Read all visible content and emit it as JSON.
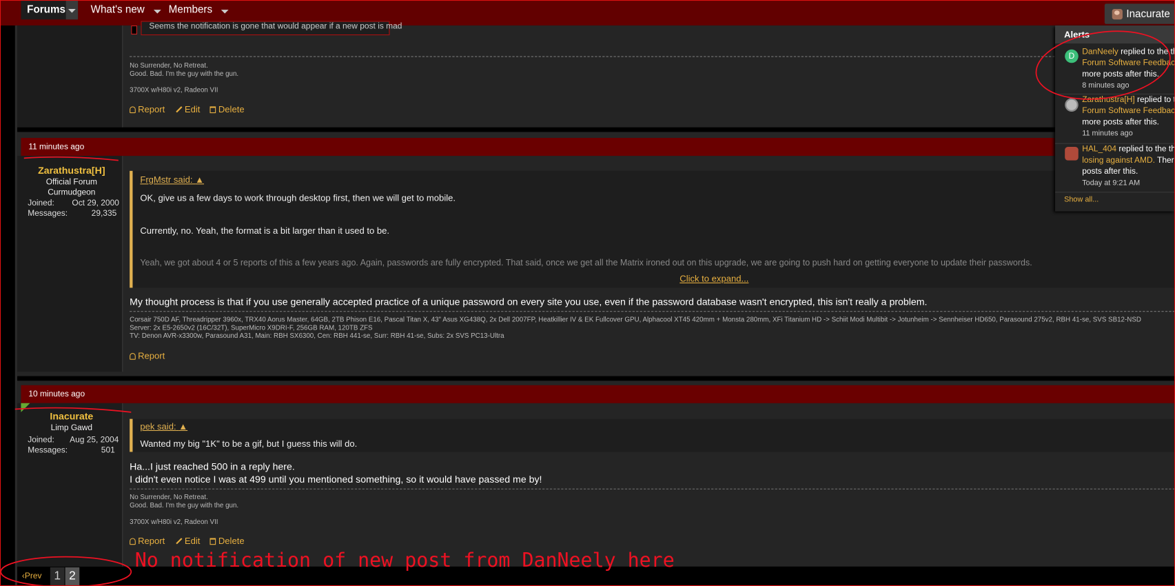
{
  "nav": {
    "forums": "Forums",
    "whats_new": "What's new",
    "members": "Members",
    "user": "Inacurate"
  },
  "top_post": {
    "quote_fragment": "Seems the notification is gone that would appear if a new post is mad",
    "signature": [
      "No Surrender, No Retreat.",
      "Good. Bad. I'm the guy with the gun.",
      "3700X w/H80i v2, Radeon VII"
    ],
    "actions": [
      "Report",
      "Edit",
      "Delete"
    ]
  },
  "post1": {
    "time": "11 minutes ago",
    "username": "Zarathustra[H]",
    "title_line1": "Official Forum",
    "title_line2": "Curmudgeon",
    "joined_label": "Joined:",
    "joined": "Oct 29, 2000",
    "messages_label": "Messages:",
    "messages": "29,335",
    "quote_author": "FrgMstr said:",
    "quote_lines": [
      "OK, give us a few days to work through desktop first, then we will get to mobile.",
      "Currently, no. Yeah, the format is a bit larger than it used to be.",
      "Yeah, we got about 4 or 5 reports of this a few years ago. Again, passwords are fully encrypted. That said, once we get all the Matrix ironed out on this upgrade, we are going to push hard on getting everyone to update their passwords."
    ],
    "expand": "Click to expand...",
    "text": "My thought process is that if you use generally accepted practice of a unique password on every site you use, even if the password database wasn't encrypted, this isn't really a problem.",
    "signature": [
      "Corsair 750D AF, Threadripper 3960x, TRX40 Aorus Master, 64GB, 2TB Phison E16, Pascal Titan X, 43\" Asus XG438Q, 2x Dell 2007FP, Heatkillier IV & EK Fullcover GPU, Alphacool XT45 420mm + Monsta 280mm, XFi Titanium HD -> Schiit Modi Multibit -> Jotunheim -> Sennheiser HD650, Parasound 275v2, RBH 41-se, SVS SB12-NSD",
      "Server: 2x E5-2650v2 (16C/32T), SuperMicro X9DRI-F, 256GB RAM, 120TB ZFS",
      "TV: Denon AVR-x3300w, Parasound A31, Main: RBH SX6300, Cen: RBH 441-se, Surr: RBH 41-se, Subs: 2x SVS PC13-Ultra"
    ],
    "actions": [
      "Report"
    ]
  },
  "post2": {
    "time": "10 minutes ago",
    "username": "Inacurate",
    "title_line1": "Limp Gawd",
    "joined_label": "Joined:",
    "joined": "Aug 25, 2004",
    "messages_label": "Messages:",
    "messages": "501",
    "quote_author": "pek said:",
    "quote_lines": [
      "Wanted my big \"1K\" to be a gif, but I guess this will do."
    ],
    "text_line1": "Ha...I just reached 500 in a reply here.",
    "text_line2": "I didn't even notice I was at 499 until you mentioned something, so it would have passed me by!",
    "signature": [
      "No Surrender, No Retreat.",
      "Good. Bad. I'm the guy with the gun.",
      "3700X w/H80i v2, Radeon VII"
    ],
    "actions": [
      "Report",
      "Edit",
      "Delete"
    ]
  },
  "alerts": {
    "title": "Alerts",
    "items": [
      {
        "user": "DanNeely",
        "action": " replied to the th",
        "thread": "Forum Software Feedback",
        "rest": "more posts after this.",
        "time": "8 minutes ago",
        "avatar_letter": "D",
        "avatar_color": "#3cbf7a"
      },
      {
        "user": "Zarathustra[H]",
        "action": " replied to t",
        "thread": "Forum Software Feedback",
        "rest": "more posts after this.",
        "time": "11 minutes ago"
      },
      {
        "user": "HAL_404",
        "action": " replied to the th",
        "thread": "losing against AMD.",
        "thread_rest": " There",
        "rest": "posts after this.",
        "time": "Today at 9:21 AM"
      }
    ],
    "show_all": "Show all..."
  },
  "pager": {
    "prev": "Prev",
    "pages": [
      "1",
      "2"
    ]
  },
  "annotation": "No notification of new post from DanNeely here",
  "colors": {
    "accent": "#e8b040",
    "header": "#6a0000",
    "annotation": "#ee1122"
  }
}
